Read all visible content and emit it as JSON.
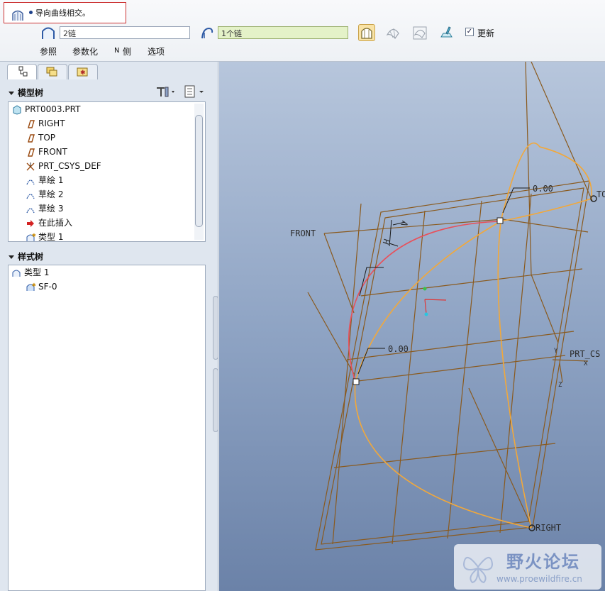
{
  "message": {
    "text": "导向曲线相交。"
  },
  "dashboard": {
    "chain1": "2链",
    "chain2": "1个链",
    "update_label": "更新",
    "update_checked": true,
    "tabs": [
      "参照",
      "参数化",
      "侧",
      "选项"
    ],
    "tab_side_prefix": "N"
  },
  "left": {
    "model_tree_title": "模型树",
    "model_tree": [
      "PRT0003.PRT",
      "RIGHT",
      "TOP",
      "FRONT",
      "PRT_CSYS_DEF",
      "草绘 1",
      "草绘 2",
      "草绘 3",
      "在此插入",
      "类型 1"
    ],
    "style_tree_title": "样式树",
    "style_tree": [
      "类型 1",
      "SF-0"
    ]
  },
  "graphics": {
    "labels": {
      "front": "FRONT",
      "top": "TO",
      "right": "RIGHT",
      "csys": "PRT_CS",
      "dim1": "0.00",
      "dim2": "0.00",
      "h": "H",
      "v": "V",
      "cs_x": "X",
      "cs_y": "Y",
      "cs_z": "Z"
    }
  },
  "watermark": {
    "title": "野火论坛",
    "url": "www.proewildfire.cn"
  },
  "colors": {
    "datum": "#8a5a1e",
    "curve_orange": "#f2a83a",
    "curve_red": "#e8505a",
    "accent_tab": "#f9e3a6"
  }
}
